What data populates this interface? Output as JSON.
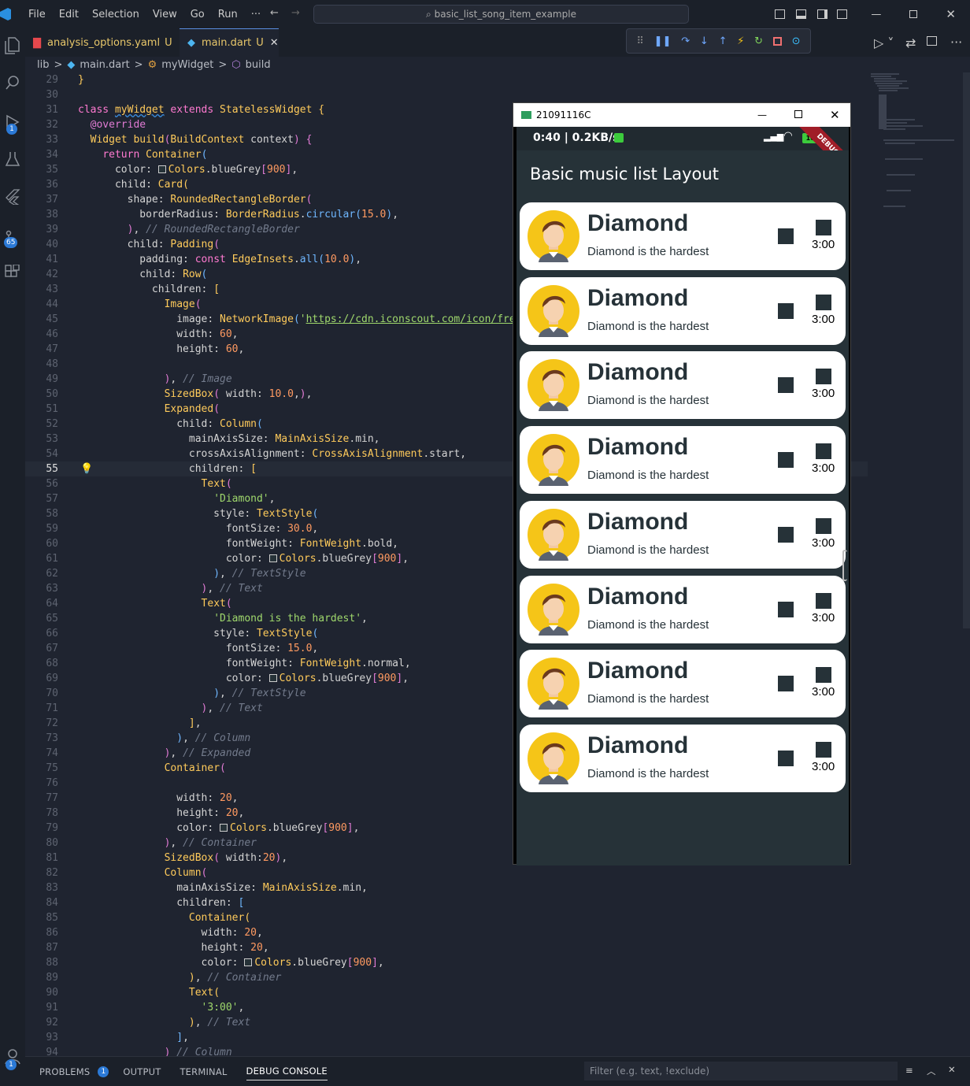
{
  "titlebar": {
    "menu": [
      "File",
      "Edit",
      "Selection",
      "View",
      "Go",
      "Run",
      "···"
    ],
    "search": "basic_list_song_item_example"
  },
  "activity": {
    "run_badge": "1",
    "source_badge": "65",
    "account_badge": "1"
  },
  "tabs": [
    {
      "label": "analysis_options.yaml",
      "status": "U",
      "color": "#e8c76a"
    },
    {
      "label": "main.dart",
      "status": "U",
      "color": "#e8c76a"
    }
  ],
  "breadcrumb": [
    "lib",
    ">",
    "main.dart",
    ">",
    "myWidget",
    ">",
    "build"
  ],
  "editor": {
    "current_line": 55
  },
  "panel": {
    "tabs": [
      "PROBLEMS",
      "OUTPUT",
      "TERMINAL",
      "DEBUG CONSOLE"
    ],
    "problems_count": "1",
    "filter_placeholder": "Filter (e.g. text, !exclude)"
  },
  "emulator": {
    "title": "21091116C",
    "status_time": "0:40 | 0.2KB/s",
    "battery": "100",
    "debug_label": "DEBUG",
    "app_title": "Basic music list Layout",
    "items": [
      {
        "title": "Diamond",
        "subtitle": "Diamond is the hardest",
        "duration": "3:00"
      },
      {
        "title": "Diamond",
        "subtitle": "Diamond is the hardest",
        "duration": "3:00"
      },
      {
        "title": "Diamond",
        "subtitle": "Diamond is the hardest",
        "duration": "3:00"
      },
      {
        "title": "Diamond",
        "subtitle": "Diamond is the hardest",
        "duration": "3:00"
      },
      {
        "title": "Diamond",
        "subtitle": "Diamond is the hardest",
        "duration": "3:00"
      },
      {
        "title": "Diamond",
        "subtitle": "Diamond is the hardest",
        "duration": "3:00"
      },
      {
        "title": "Diamond",
        "subtitle": "Diamond is the hardest",
        "duration": "3:00"
      },
      {
        "title": "Diamond",
        "subtitle": "Diamond is the hardest",
        "duration": "3:00"
      }
    ]
  }
}
